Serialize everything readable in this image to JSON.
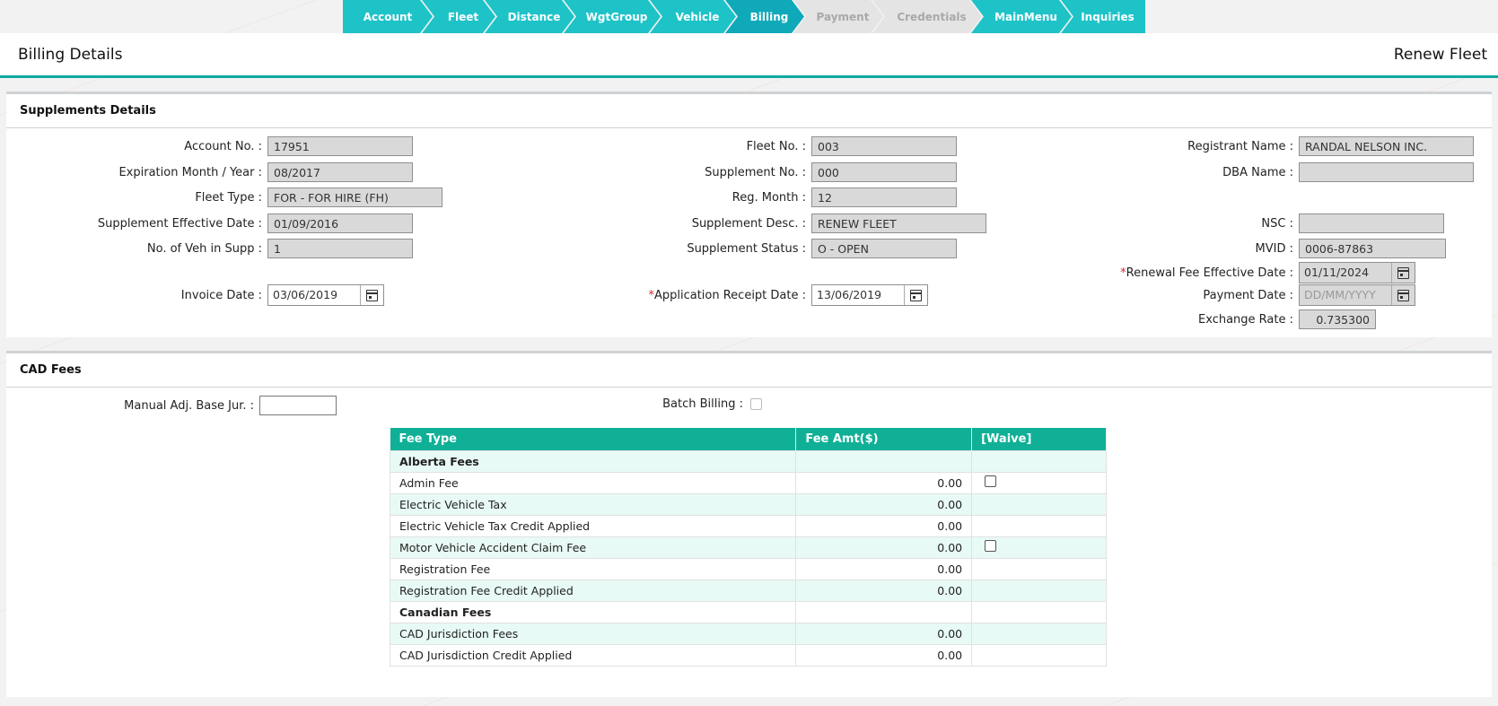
{
  "wizard": {
    "steps": [
      {
        "label": "Account",
        "state": "done"
      },
      {
        "label": "Fleet",
        "state": "done"
      },
      {
        "label": "Distance",
        "state": "done"
      },
      {
        "label": "WgtGroup",
        "state": "done"
      },
      {
        "label": "Vehicle",
        "state": "done"
      },
      {
        "label": "Billing",
        "state": "active"
      },
      {
        "label": "Payment",
        "state": "disabled"
      },
      {
        "label": "Credentials",
        "state": "disabled"
      },
      {
        "label": "MainMenu",
        "state": "done"
      },
      {
        "label": "Inquiries",
        "state": "done"
      }
    ]
  },
  "header": {
    "title": "Billing Details",
    "action": "Renew Fleet"
  },
  "supplements": {
    "title": "Supplements Details",
    "account_no": {
      "label": "Account No. :",
      "value": "17951"
    },
    "expiration": {
      "label": "Expiration Month / Year :",
      "value": "08/2017"
    },
    "fleet_type": {
      "label": "Fleet Type :",
      "value": "FOR - FOR HIRE (FH)"
    },
    "supp_eff_date": {
      "label": "Supplement Effective Date :",
      "value": "01/09/2016"
    },
    "num_veh": {
      "label": "No. of Veh in Supp :",
      "value": "1"
    },
    "invoice_date": {
      "label": "Invoice Date :",
      "value": "03/06/2019"
    },
    "fleet_no": {
      "label": "Fleet No. :",
      "value": "003"
    },
    "supplement_no": {
      "label": "Supplement No. :",
      "value": "000"
    },
    "reg_month": {
      "label": "Reg. Month :",
      "value": "12"
    },
    "supp_desc": {
      "label": "Supplement Desc. :",
      "value": "RENEW FLEET"
    },
    "supp_status": {
      "label": "Supplement Status :",
      "value": "O - OPEN"
    },
    "app_receipt_date": {
      "label": "Application Receipt Date :",
      "required": "*",
      "value": "13/06/2019"
    },
    "registrant_name": {
      "label": "Registrant Name :",
      "value": "RANDAL NELSON INC."
    },
    "dba_name": {
      "label": "DBA Name :",
      "value": ""
    },
    "nsc": {
      "label": "NSC :",
      "value": ""
    },
    "mvid": {
      "label": "MVID :",
      "value": "0006-87863"
    },
    "renewal_fee_eff_date": {
      "label": "Renewal Fee Effective Date :",
      "required": "*",
      "value": "01/11/2024"
    },
    "payment_date": {
      "label": "Payment Date :",
      "placeholder": "DD/MM/YYYY"
    },
    "exchange_rate": {
      "label": "Exchange Rate :",
      "value": "0.735300"
    }
  },
  "cad": {
    "title": "CAD Fees",
    "manual_adj": {
      "label": "Manual Adj. Base Jur. :",
      "value": ""
    },
    "batch_billing": {
      "label": "Batch Billing :"
    },
    "table": {
      "headers": [
        "Fee Type",
        "Fee Amt($)",
        "[Waive]"
      ],
      "rows": [
        {
          "type": "Alberta Fees",
          "amt": "",
          "group": true,
          "waive": false
        },
        {
          "type": "Admin Fee",
          "amt": "0.00",
          "group": false,
          "waive": true
        },
        {
          "type": "Electric Vehicle Tax",
          "amt": "0.00",
          "group": false,
          "waive": false
        },
        {
          "type": "Electric Vehicle Tax Credit Applied",
          "amt": "0.00",
          "group": false,
          "waive": false
        },
        {
          "type": "Motor Vehicle Accident Claim Fee",
          "amt": "0.00",
          "group": false,
          "waive": true
        },
        {
          "type": "Registration Fee",
          "amt": "0.00",
          "group": false,
          "waive": false
        },
        {
          "type": "Registration Fee Credit Applied",
          "amt": "0.00",
          "group": false,
          "waive": false
        },
        {
          "type": "Canadian Fees",
          "amt": "",
          "group": true,
          "waive": false
        },
        {
          "type": "CAD Jurisdiction Fees",
          "amt": "0.00",
          "group": false,
          "waive": false
        },
        {
          "type": "CAD Jurisdiction Credit Applied",
          "amt": "0.00",
          "group": false,
          "waive": false
        }
      ]
    }
  }
}
